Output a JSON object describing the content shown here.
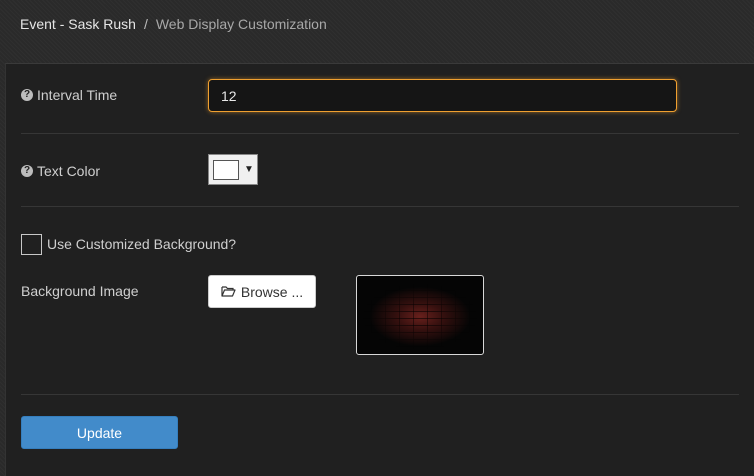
{
  "breadcrumb": {
    "parent": "Event - Sask Rush",
    "separator": "/",
    "current": "Web Display Customization"
  },
  "form": {
    "interval": {
      "label": "Interval Time",
      "help_icon": "question-circle-icon",
      "value": "12"
    },
    "text_color": {
      "label": "Text Color",
      "help_icon": "question-circle-icon",
      "value": "#ffffff",
      "arrow": "▼"
    },
    "custom_background": {
      "label": "Use Customized Background?",
      "checked": false
    },
    "background_image": {
      "label": "Background Image",
      "browse_label": "Browse ...",
      "browse_icon": "folder-open-icon",
      "preview": "dark red brick wall"
    },
    "update_label": "Update"
  },
  "colors": {
    "accent_focus": "#f0a030",
    "primary_button": "#428bca",
    "background": "#2a2a2a",
    "panel": "#202020"
  }
}
